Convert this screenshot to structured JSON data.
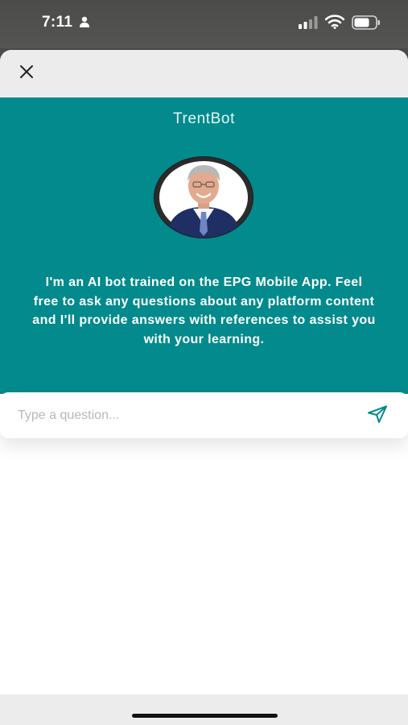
{
  "status_bar": {
    "time": "7:11",
    "icons": [
      "person-icon",
      "cellular-signal-icon",
      "wifi-icon",
      "battery-icon"
    ]
  },
  "header": {
    "close_icon": "close-icon"
  },
  "hero": {
    "bot_name": "TrentBot",
    "intro_text": "I'm an AI bot trained on the EPG Mobile App. Feel free to ask any questions about any platform content and I'll provide answers with references to assist you with your learning.",
    "background_color": "#028a8c"
  },
  "input": {
    "placeholder": "Type a question...",
    "value": "",
    "send_icon": "send-icon",
    "accent_color": "#028a8c"
  }
}
